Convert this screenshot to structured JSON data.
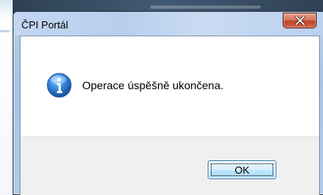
{
  "window": {
    "title": "ČPI Portál"
  },
  "message": {
    "text": "Operace úspěšně ukončena.",
    "icon": "info-icon"
  },
  "buttons": {
    "ok_label": "OK"
  },
  "colors": {
    "close_button": "#c0402a",
    "info_icon": "#1f66c0",
    "ok_button_border": "#3c7fb1"
  }
}
